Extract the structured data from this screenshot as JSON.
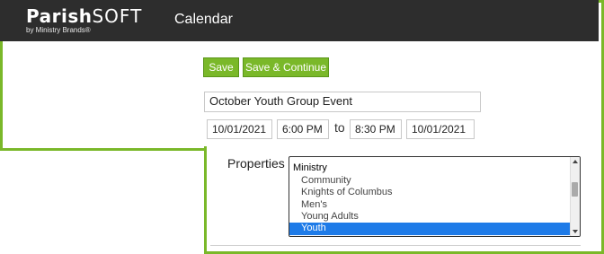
{
  "header": {
    "logo_main_bold": "Parish",
    "logo_main_soft": "SOFT",
    "logo_sub": "by Ministry Brands®",
    "title": "Calendar"
  },
  "toolbar": {
    "save_label": "Save",
    "save_continue_label": "Save & Continue"
  },
  "event": {
    "name": "October Youth Group Event",
    "start_date": "10/01/2021",
    "start_time": "6:00 PM",
    "to_label": "to",
    "end_time": "8:30 PM",
    "end_date": "10/01/2021"
  },
  "properties": {
    "label": "Properties",
    "group_label": "Ministry",
    "options": [
      "Community",
      "Knights of Columbus",
      "Men's",
      "Young Adults",
      "Youth"
    ],
    "selected": "Youth"
  },
  "colors": {
    "accent_green": "#7ab829",
    "topbar_bg": "#2d2d2d",
    "selection_blue": "#1e7be8"
  }
}
